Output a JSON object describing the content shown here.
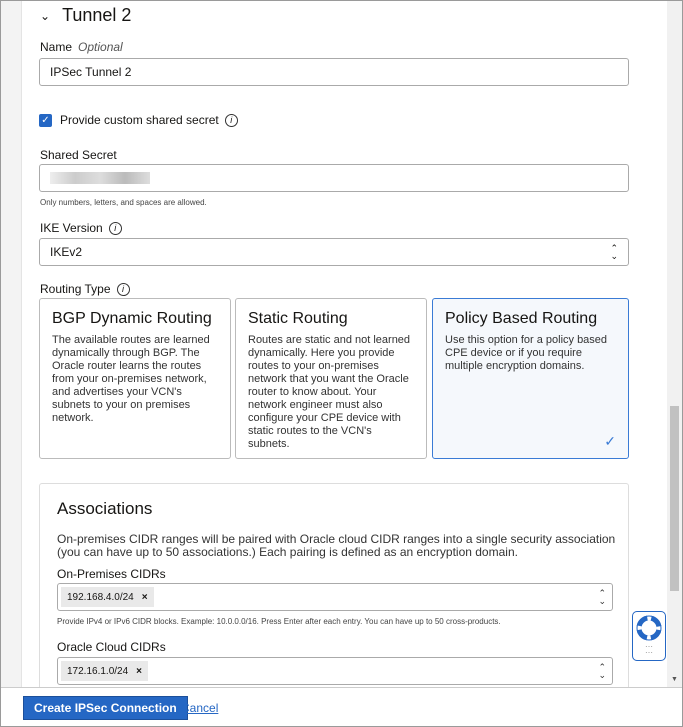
{
  "section": {
    "title": "Tunnel 2"
  },
  "name_field": {
    "label": "Name",
    "optional": "Optional",
    "value": "IPSec Tunnel 2"
  },
  "custom_secret": {
    "label": "Provide custom shared secret",
    "checked": true
  },
  "shared_secret": {
    "label": "Shared Secret",
    "hint": "Only numbers, letters, and spaces are allowed."
  },
  "ike": {
    "label": "IKE Version",
    "value": "IKEv2"
  },
  "routing": {
    "label": "Routing Type",
    "options": [
      {
        "title": "BGP Dynamic Routing",
        "desc": "The available routes are learned dynamically through BGP. The Oracle router learns the routes from your on-premises network, and advertises your VCN's subnets to your on premises network."
      },
      {
        "title": "Static Routing",
        "desc": "Routes are static and not learned dynamically. Here you provide routes to your on-premises network that you want the Oracle router to know about. Your network engineer must also configure your CPE device with static routes to the VCN's subnets."
      },
      {
        "title": "Policy Based Routing",
        "desc": "Use this option for a policy based CPE device or if you require multiple encryption domains.",
        "selected": true
      }
    ]
  },
  "associations": {
    "title": "Associations",
    "desc": "On-premises CIDR ranges will be paired with Oracle cloud CIDR ranges into a single security association (you can have up to 50 associations.) Each pairing is defined as an encryption domain.",
    "onprem_label": "On-Premises CIDRs",
    "onprem_tags": [
      "192.168.4.0/24"
    ],
    "onprem_hint": "Provide IPv4 or IPv6 CIDR blocks. Example: 10.0.0.0/16. Press Enter after each entry. You can have up to 50 cross-products.",
    "cloud_label": "Oracle Cloud CIDRs",
    "cloud_tags": [
      "172.16.1.0/24"
    ]
  },
  "footer": {
    "create": "Create IPSec Connection",
    "cancel": "Cancel"
  }
}
